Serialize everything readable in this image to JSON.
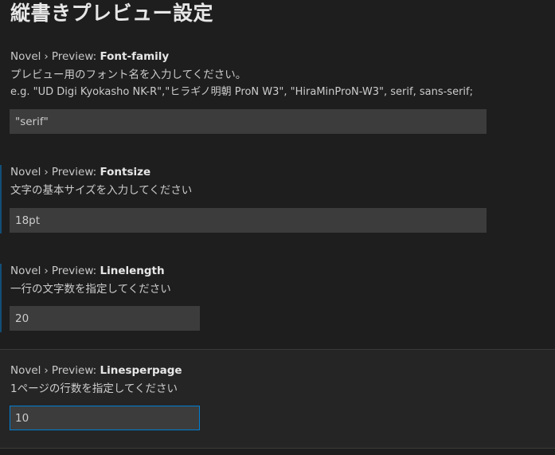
{
  "section": {
    "title": "縦書きプレビュー設定"
  },
  "settings": [
    {
      "category": "Novel",
      "separator": "›",
      "subcategory": "Preview:",
      "key": "Font-family",
      "description": "プレビュー用のフォント名を入力してください。",
      "description2": "e.g. \"UD Digi Kyokasho NK-R\",\"ヒラギノ明朝 ProN W3\", \"HiraMinProN-W3\", serif, sans-serif;",
      "value": "\"serif\""
    },
    {
      "category": "Novel",
      "separator": "›",
      "subcategory": "Preview:",
      "key": "Fontsize",
      "description": "文字の基本サイズを入力してください",
      "value": "18pt"
    },
    {
      "category": "Novel",
      "separator": "›",
      "subcategory": "Preview:",
      "key": "Linelength",
      "description": "一行の文字数を指定してください",
      "value": "20"
    },
    {
      "category": "Novel",
      "separator": "›",
      "subcategory": "Preview:",
      "key": "Linesperpage",
      "description": "1ページの行数を指定してください",
      "value": "10"
    }
  ],
  "colors": {
    "background": "#1e1e1e",
    "focused_row": "#252526",
    "input_bg": "#3c3c3c",
    "focus_border": "#007fd4",
    "modified_bar": "#0e639c"
  }
}
